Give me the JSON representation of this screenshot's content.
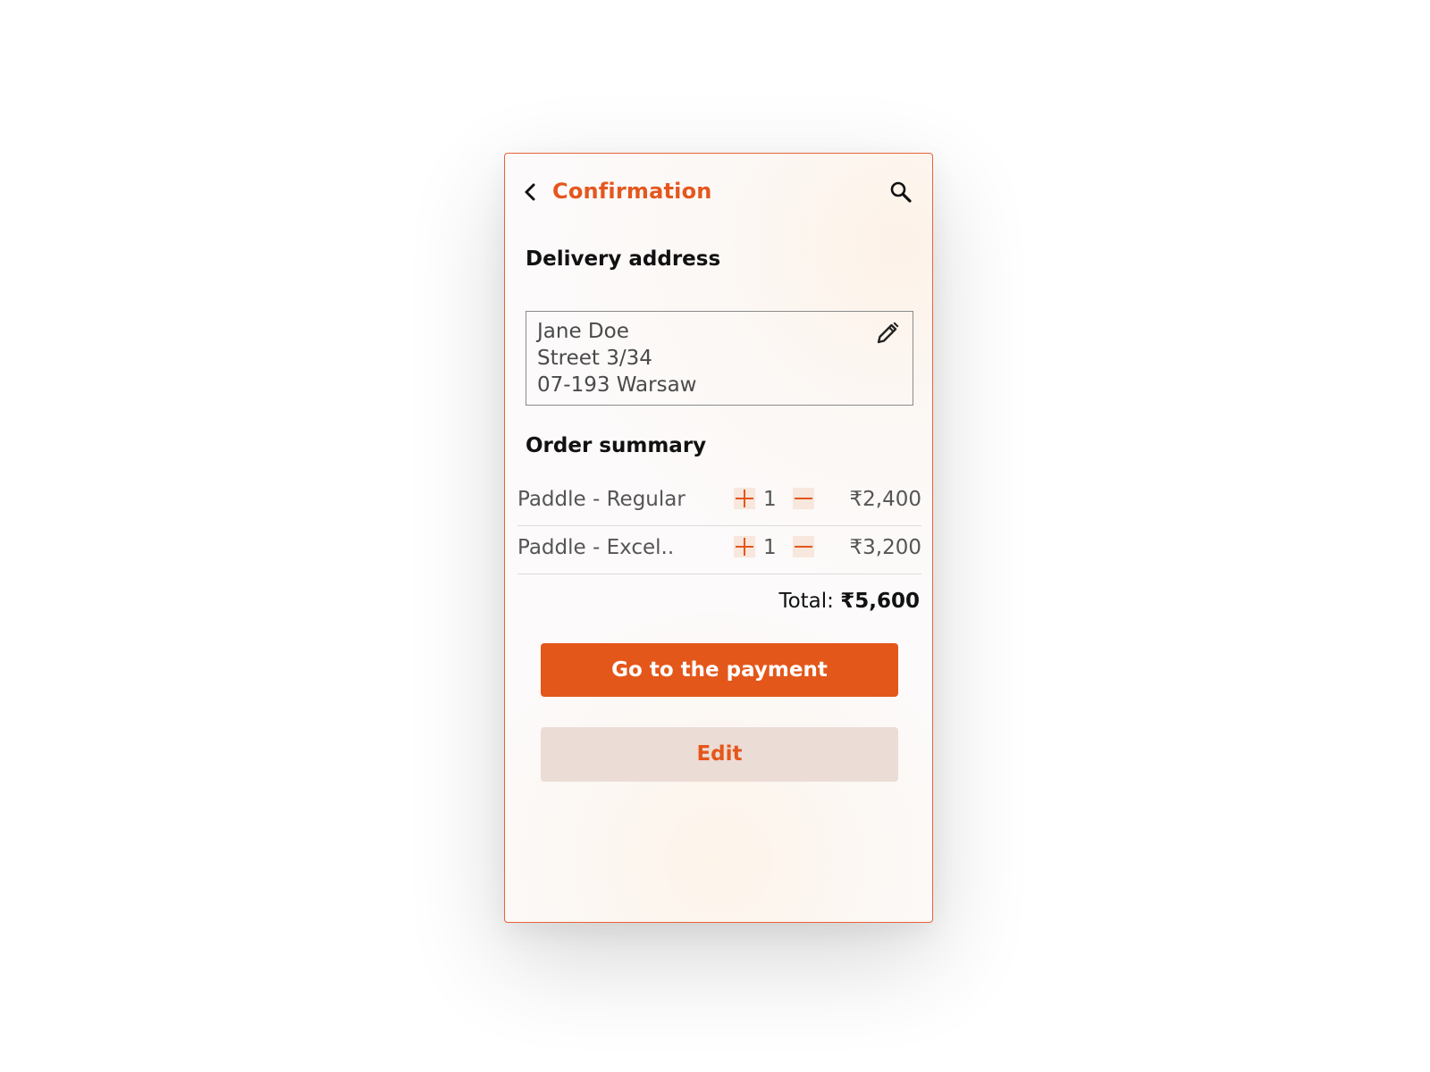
{
  "header": {
    "title": "Confirmation",
    "back_icon": "chevron-left-icon",
    "search_icon": "search-icon"
  },
  "delivery": {
    "heading": "Delivery address",
    "lines": [
      "Jane Doe",
      "Street 3/34",
      "07-193 Warsaw"
    ],
    "edit_icon": "pencil-icon"
  },
  "order": {
    "heading": "Order summary",
    "items": [
      {
        "name": "Paddle - Regular",
        "quantity": "1",
        "price": "₹2,400"
      },
      {
        "name": "Paddle - Excel..",
        "quantity": "1",
        "price": "₹3,200"
      }
    ],
    "total_label": "Total:",
    "total_value": "₹5,600"
  },
  "actions": {
    "primary_label": "Go to the payment",
    "secondary_label": "Edit"
  },
  "colors": {
    "accent": "#e4571a",
    "accent_light": "#ecdcd6",
    "qty_button_bg": "#f7e7dd",
    "text_dark": "#111111",
    "text_muted": "#555555"
  }
}
